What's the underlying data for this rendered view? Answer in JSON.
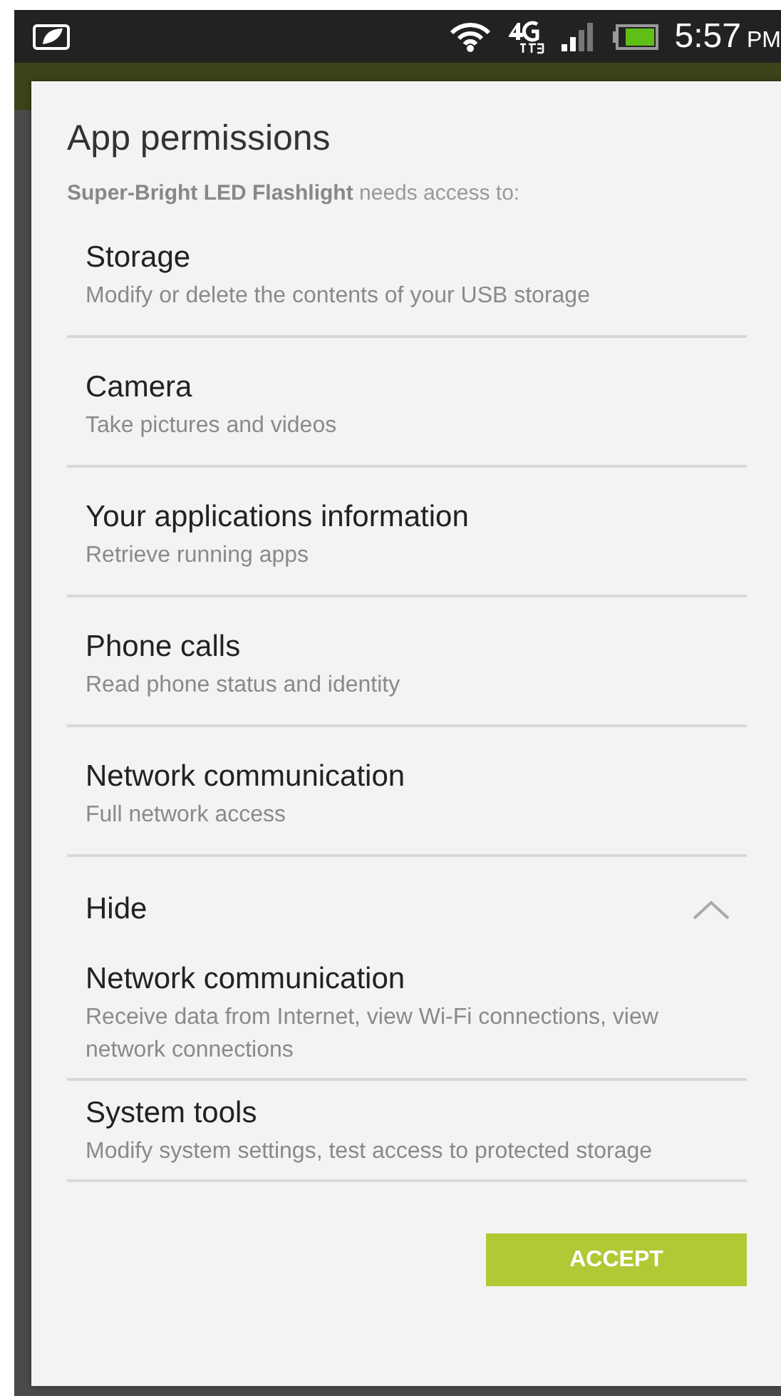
{
  "status_bar": {
    "time": "5:57",
    "ampm": "PM"
  },
  "dialog": {
    "title": "App permissions",
    "intro": "**Super-Bright LED Flashlight** needs access to:",
    "permissions": [
      {
        "title": "Storage",
        "description": "Modify or delete the contents of your USB storage"
      },
      {
        "title": "Camera",
        "description": "Take pictures and videos"
      },
      {
        "title": "Your applications information",
        "description": "Retrieve running apps"
      },
      {
        "title": "Phone calls",
        "description": "Read phone status and identity"
      },
      {
        "title": "Network communication",
        "description": "Full network access"
      }
    ],
    "more": {
      "label": "Hide",
      "expanded": true,
      "permissions": [
        {
          "title": "Network communication",
          "description": "Receive data from Internet, view Wi-Fi connections, view network connections"
        },
        {
          "title": "System tools",
          "description": "Modify system settings, test access to protected storage"
        }
      ]
    },
    "button": "ACCEPT"
  }
}
